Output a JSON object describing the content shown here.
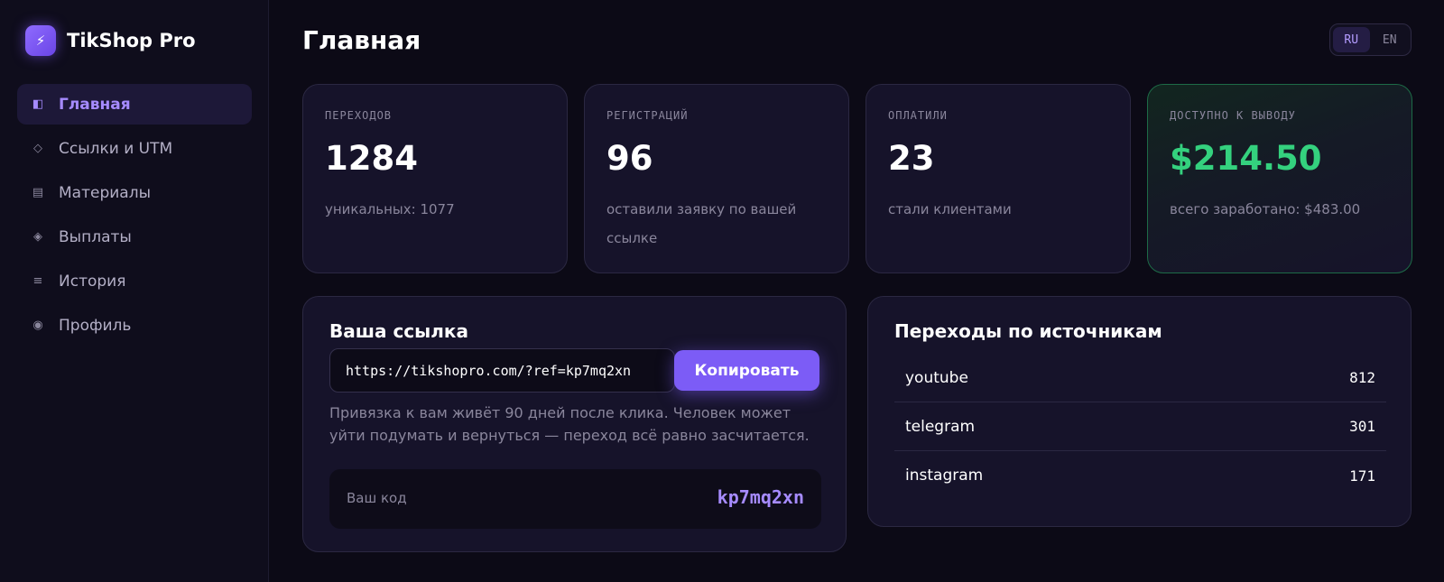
{
  "app": {
    "name": "TikShop Pro",
    "logo_icon": "lightning-icon",
    "accent": "#7c5cf6"
  },
  "sidebar": {
    "items": [
      {
        "label": "Главная",
        "icon": "layout-icon",
        "glyph": "◧",
        "active": true
      },
      {
        "label": "Ссылки и UTM",
        "icon": "diamond-outline-icon",
        "glyph": "◇",
        "active": false
      },
      {
        "label": "Материалы",
        "icon": "document-icon",
        "glyph": "▤",
        "active": false
      },
      {
        "label": "Выплаты",
        "icon": "diamond-filled-icon",
        "glyph": "◈",
        "active": false
      },
      {
        "label": "История",
        "icon": "list-icon",
        "glyph": "≡",
        "active": false
      },
      {
        "label": "Профиль",
        "icon": "user-circle-icon",
        "glyph": "◉",
        "active": false
      }
    ]
  },
  "header": {
    "title": "Главная",
    "languages": [
      "RU",
      "EN"
    ],
    "selected_language": "RU"
  },
  "stats": [
    {
      "label": "ПЕРЕХОДОВ",
      "value": "1284",
      "sub": "уникальных: 1077"
    },
    {
      "label": "РЕГИСТРАЦИЙ",
      "value": "96",
      "sub": "оставили заявку по вашей ссылке"
    },
    {
      "label": "ОПЛАТИЛИ",
      "value": "23",
      "sub": "стали клиентами"
    },
    {
      "label": "ДОСТУПНО К ВЫВОДУ",
      "value": "$214.50",
      "sub": "всего заработано: $483.00",
      "color": "#34d17e"
    }
  ],
  "referral": {
    "title": "Ваша ссылка",
    "url": "https://tikshopro.com/?ref=kp7mq2xn",
    "copy_label": "Копировать",
    "hint": "Привязка к вам живёт 90 дней после клика. Человек может уйти подумать и вернуться — переход всё равно засчитается.",
    "code_label": "Ваш код",
    "code": "kp7mq2xn"
  },
  "sources": {
    "title": "Переходы по источникам",
    "rows": [
      {
        "name": "youtube",
        "count": "812"
      },
      {
        "name": "telegram",
        "count": "301"
      },
      {
        "name": "instagram",
        "count": "171"
      }
    ]
  }
}
